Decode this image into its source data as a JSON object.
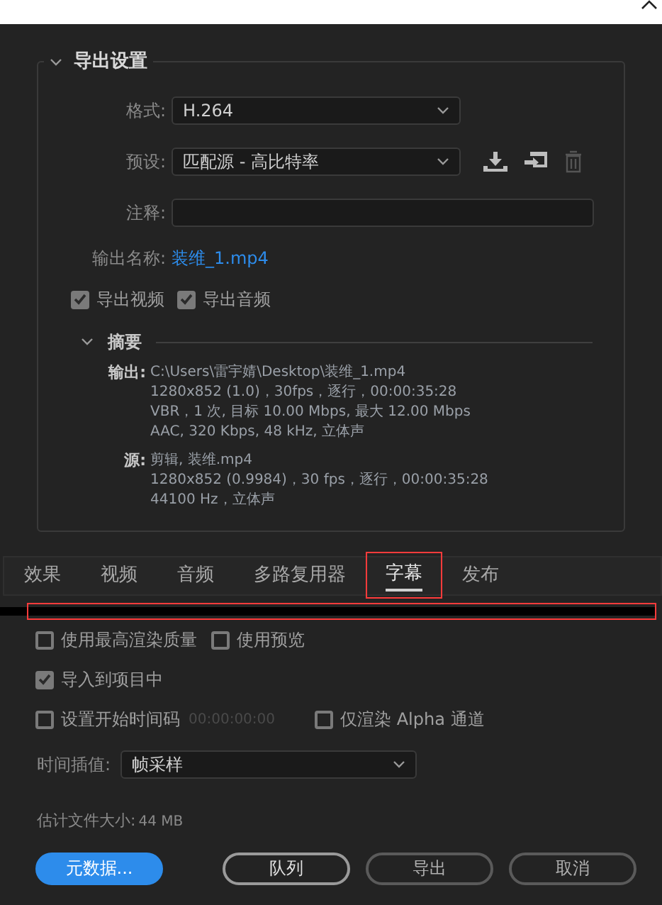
{
  "export_settings": {
    "title": "导出设置",
    "expanded": true,
    "format": {
      "label": "格式:",
      "value": "H.264"
    },
    "preset": {
      "label": "预设:",
      "value": "匹配源 - 高比特率"
    },
    "comment": {
      "label": "注释:"
    },
    "output_name": {
      "label": "输出名称:",
      "value": "装维_1.mp4"
    },
    "checkboxes": [
      {
        "label": "导出视频",
        "checked": true
      },
      {
        "label": "导出音频",
        "checked": true
      }
    ],
    "summary": {
      "title": "摘要",
      "expanded": true,
      "output": {
        "label": "输出:",
        "lines": [
          "C:\\Users\\雷宇婧\\Desktop\\装维_1.mp4",
          "1280x852 (1.0)，30fps，逐行，00:00:35:28",
          "VBR，1 次, 目标 10.00 Mbps, 最大 12.00 Mbps",
          "AAC, 320 Kbps, 48  kHz, 立体声"
        ]
      },
      "source": {
        "label": "源:",
        "lines": [
          "剪辑, 装维.mp4",
          "1280x852  (0.9984)，30 fps，逐行，00:00:35:28",
          "44100 Hz，立体声"
        ]
      }
    }
  },
  "tabs": [
    {
      "label": "效果",
      "selected": false,
      "highlighted": false
    },
    {
      "label": "视频",
      "selected": false,
      "highlighted": false
    },
    {
      "label": "音频",
      "selected": false,
      "highlighted": false
    },
    {
      "label": "多路复用器",
      "selected": false,
      "highlighted": false
    },
    {
      "label": "字幕",
      "selected": true,
      "highlighted": true
    },
    {
      "label": "发布",
      "selected": false,
      "highlighted": false
    }
  ],
  "tab_content": {
    "highlighted": true
  },
  "options": [
    [
      {
        "kind": "checkbox",
        "label": "使用最高渲染质量",
        "checked": false
      },
      {
        "kind": "checkbox",
        "label": "使用预览",
        "checked": false
      }
    ],
    [
      {
        "kind": "checkbox",
        "label": "导入到项目中",
        "checked": true
      }
    ],
    [
      {
        "kind": "checkbox",
        "label": "设置开始时间码",
        "checked": false
      },
      {
        "kind": "timecode",
        "value": "00:00:00:00"
      },
      {
        "kind": "checkbox",
        "label": "仅渲染 Alpha 通道",
        "checked": false
      }
    ]
  ],
  "time_interpolation": {
    "label": "时间插值:",
    "value": "帧采样"
  },
  "file_size": {
    "label": "估计文件大小:",
    "value": "44 MB"
  },
  "buttons": [
    {
      "label": "元数据...",
      "kind": "primary"
    },
    {
      "label": "队列",
      "kind": "strong"
    },
    {
      "label": "导出",
      "kind": "normal"
    },
    {
      "label": "取消",
      "kind": "normal"
    }
  ]
}
